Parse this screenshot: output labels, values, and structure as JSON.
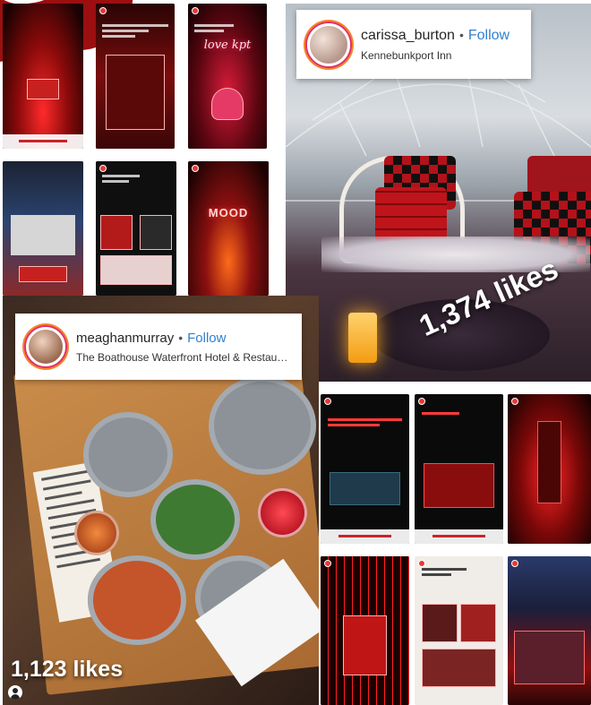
{
  "posts": [
    {
      "username": "carissa_burton",
      "follow_label": "Follow",
      "location": "Kennebunkport Inn",
      "likes": "1,374 likes"
    },
    {
      "username": "meaghanmurray",
      "follow_label": "Follow",
      "location": "The Boathouse Waterfront Hotel & Restau…",
      "likes": "1,123 likes"
    }
  ],
  "story_lettering": [
    "love kpt",
    "MOOD"
  ],
  "colors": {
    "follow_blue": "#2f80d1",
    "story_red": "#c7211f",
    "brand_red": "#9b0f10"
  }
}
